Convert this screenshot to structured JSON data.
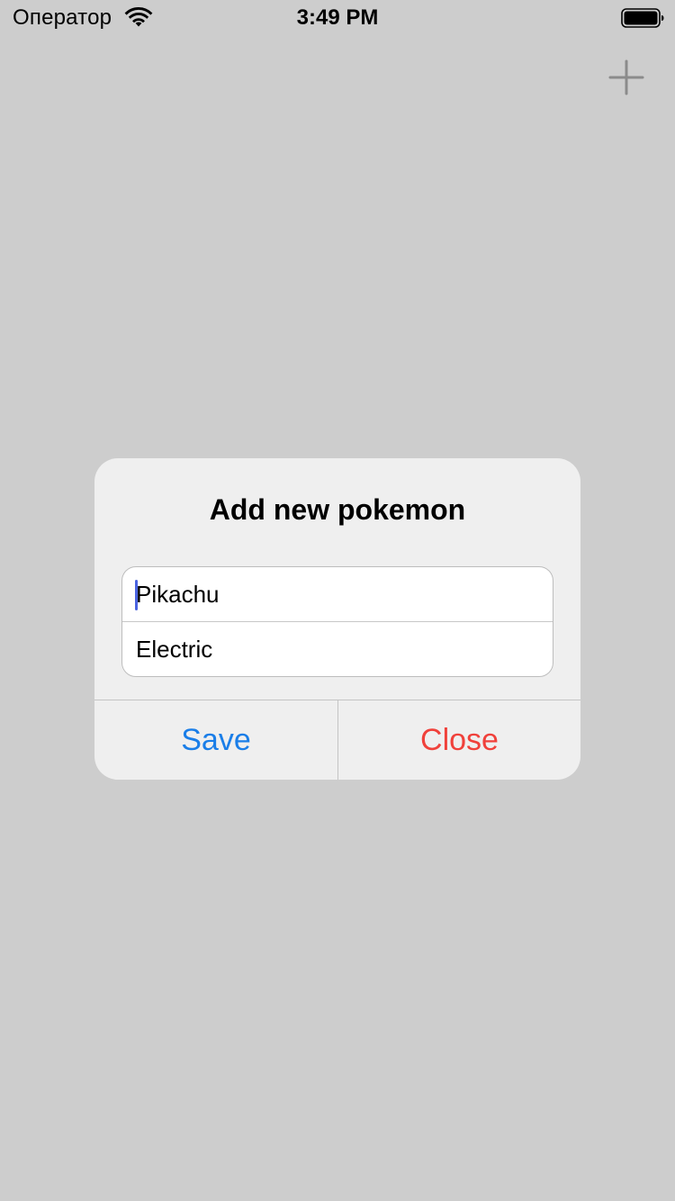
{
  "status_bar": {
    "carrier": "Оператор",
    "time": "3:49 PM",
    "wifi_icon": "wifi-icon",
    "battery_icon": "battery-full-icon"
  },
  "nav": {
    "add_icon": "plus-icon"
  },
  "alert": {
    "title": "Add new pokemon",
    "fields": [
      {
        "value": "Pikachu",
        "focused": true
      },
      {
        "value": "Electric",
        "focused": false
      }
    ],
    "buttons": {
      "save_label": "Save",
      "close_label": "Close"
    },
    "colors": {
      "save": "#1a7ee8",
      "close": "#f0413b",
      "caret": "#4a63e0"
    }
  }
}
